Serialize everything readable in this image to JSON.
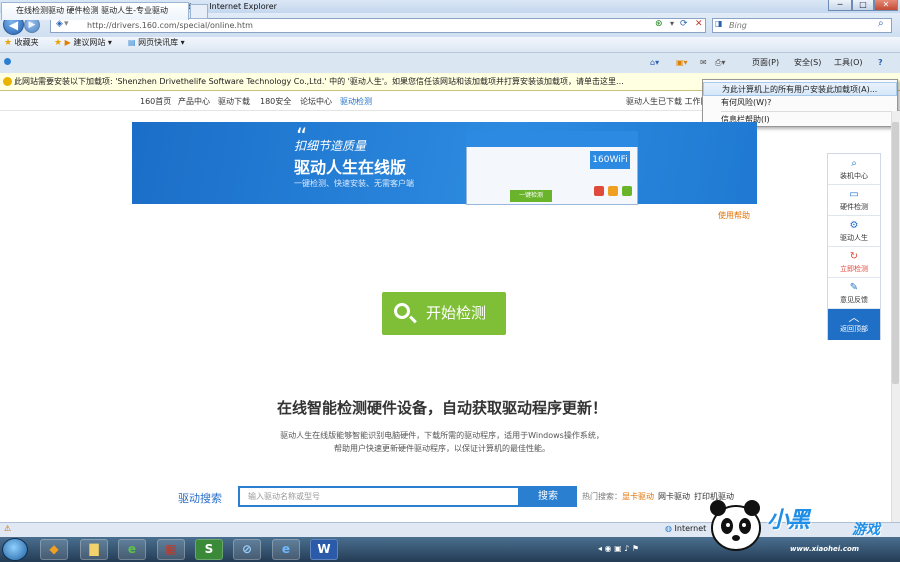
{
  "window": {
    "title": "在线检测驱动 硬件检测 驱动人生官网驱动 - Windows Internet Explorer",
    "btn_min": "─",
    "btn_max": "□",
    "btn_close": "✕"
  },
  "nav": {
    "url": "http://drivers.160.com/special/online.htm",
    "search_placeholder": "Bing"
  },
  "favorites": {
    "fav_label": "收藏夹",
    "suggested": "建议网站",
    "gallery": "网页快讯库"
  },
  "tab": {
    "label": "在线检测驱动 硬件检测 驱动人生-专业驱动"
  },
  "commandbar": {
    "page": "页面(P)",
    "safety": "安全(S)",
    "tools": "工具(O)",
    "help": "?"
  },
  "infobar": {
    "text": "此网站需要安装以下加载项: 'Shenzhen Drivethelife Software Technology Co.,Ltd.' 中的 '驱动人生'。如果您信任该网站和该加载项并打算安装该加载项，请单击这里..."
  },
  "context_menu": {
    "items": [
      "为此计算机上的所有用户安装此加载项(A)...",
      "有何风险(W)?",
      "信息栏帮助(I)"
    ]
  },
  "site_nav": {
    "items": [
      "160首页",
      "产品中心",
      "驱动下载",
      "180安全",
      "论坛中心",
      "驱动检测"
    ],
    "right": "驱动人生已下载 工作区"
  },
  "banner": {
    "quote": "“",
    "line1": "扣细节造质量",
    "line2": "驱动人生在线版",
    "line3": "一键检测、快速安装、无需客户端",
    "mock_wifi": "160WiFi",
    "mock_btn": "一键检测"
  },
  "feedback": "使用帮助",
  "main": {
    "detect_button": "开始检测",
    "headline": "在线智能检测硬件设备，自动获取驱动程序更新！",
    "desc1": "驱动人生在线版能够智能识别电脑硬件，下载所需的驱动程序，适用于Windows操作系统，",
    "desc2": "帮助用户快速更新硬件驱动程序，以保证计算机的最佳性能。"
  },
  "driver_search": {
    "label": "驱动搜索",
    "placeholder": "输入驱动名称或型号",
    "button": "搜索",
    "hot_label": "热门搜索：",
    "hot_items": [
      "显卡驱动",
      "网卡驱动",
      "打印机驱动"
    ],
    "hot_color": "#e07000"
  },
  "side_float": {
    "items": [
      "装机中心",
      "硬件检测",
      "驱动人生",
      "立即检测",
      "意见反馈"
    ],
    "top": "返回顶部"
  },
  "statusbar": {
    "zone": "Internet"
  },
  "taskbar": {
    "items": [
      "S",
      "IE",
      "W"
    ]
  },
  "watermark": {
    "brand": "小黑",
    "game": "游戏",
    "url": "www.xiaohei.com"
  },
  "colors": {
    "accent": "#2a7fd0",
    "detect_green": "#7fbf37",
    "banner_blue": "#2c8be0"
  }
}
